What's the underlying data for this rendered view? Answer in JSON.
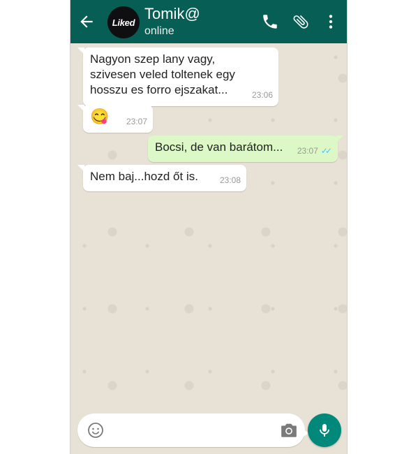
{
  "header": {
    "contact_name": "Tomik@",
    "status": "online",
    "avatar_text": "Liked",
    "icons": [
      "back-arrow-icon",
      "phone-icon",
      "paperclip-icon",
      "more-vert-icon"
    ]
  },
  "messages": [
    {
      "direction": "in",
      "text_lines": [
        "Nagyon szep lany vagy,",
        "szivesen veled toltenek egy",
        "hosszu es forro ejszakat..."
      ],
      "time": "23:06"
    },
    {
      "direction": "in",
      "text": "😋",
      "time": "23:07"
    },
    {
      "direction": "out",
      "text": "Bocsi, de van barátom...",
      "time": "23:07",
      "read_receipt": "✓✓"
    },
    {
      "direction": "in",
      "text": "Nem baj...hozd őt is.",
      "time": "23:08"
    }
  ],
  "composer": {
    "placeholder": "",
    "icons": [
      "emoji-icon",
      "camera-icon",
      "microphone-icon"
    ]
  },
  "colors": {
    "header": "#075e54",
    "chat_background": "#e7e1d6",
    "incoming_bubble": "#ffffff",
    "outgoing_bubble": "#dcf8c6",
    "mic_button": "#00897b",
    "read_ticks": "#4fc3f7"
  }
}
